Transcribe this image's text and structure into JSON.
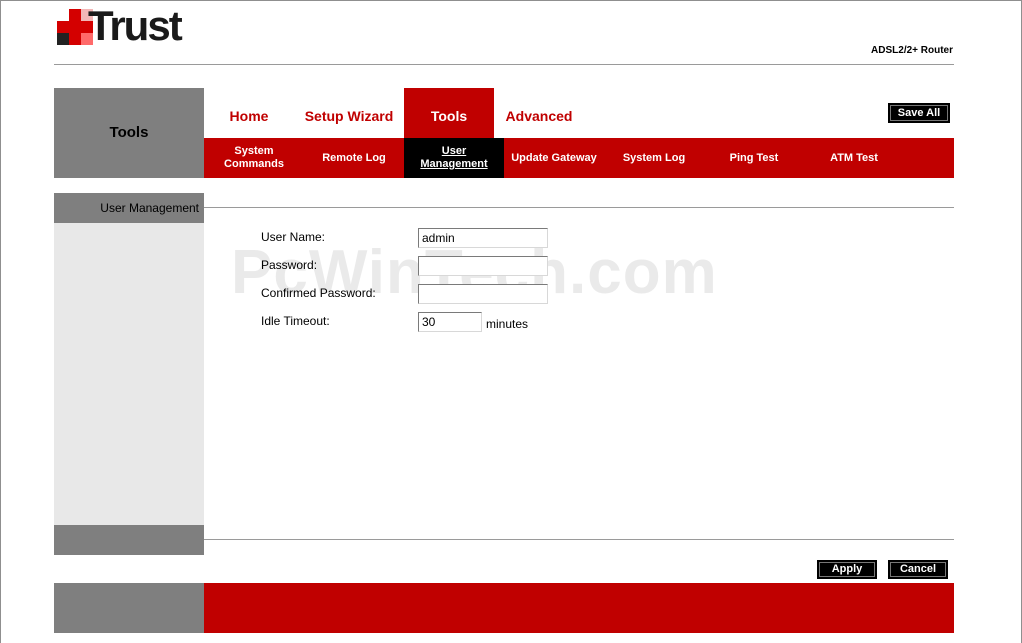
{
  "header": {
    "brand": "Trust",
    "product": "ADSL2/2+ Router"
  },
  "section": {
    "title": "Tools"
  },
  "main_nav": {
    "tabs": [
      {
        "label": "Home",
        "active": false
      },
      {
        "label": "Setup Wizard",
        "active": false
      },
      {
        "label": "Tools",
        "active": true
      },
      {
        "label": "Advanced",
        "active": false
      }
    ],
    "save_all": "Save All"
  },
  "sub_nav": {
    "tabs": [
      {
        "label": "System Commands",
        "active": false
      },
      {
        "label": "Remote Log",
        "active": false
      },
      {
        "label": "User Management",
        "active": true
      },
      {
        "label": "Update Gateway",
        "active": false
      },
      {
        "label": "System Log",
        "active": false
      },
      {
        "label": "Ping Test",
        "active": false
      },
      {
        "label": "ATM Test",
        "active": false
      }
    ]
  },
  "sidebar": {
    "label": "User Management"
  },
  "form": {
    "user_name": {
      "label": "User Name:",
      "value": "admin"
    },
    "password": {
      "label": "Password:",
      "value": ""
    },
    "confirmed_password": {
      "label": "Confirmed Password:",
      "value": ""
    },
    "idle_timeout": {
      "label": "Idle Timeout:",
      "value": "30",
      "unit": "minutes"
    }
  },
  "watermark": "PcWinTech.com",
  "actions": {
    "apply": "Apply",
    "cancel": "Cancel"
  },
  "colors": {
    "brand_red": "#c00000",
    "grey": "#7f7f7f",
    "sidebar_bg": "#e8e8e8",
    "button_bg": "#000000"
  }
}
